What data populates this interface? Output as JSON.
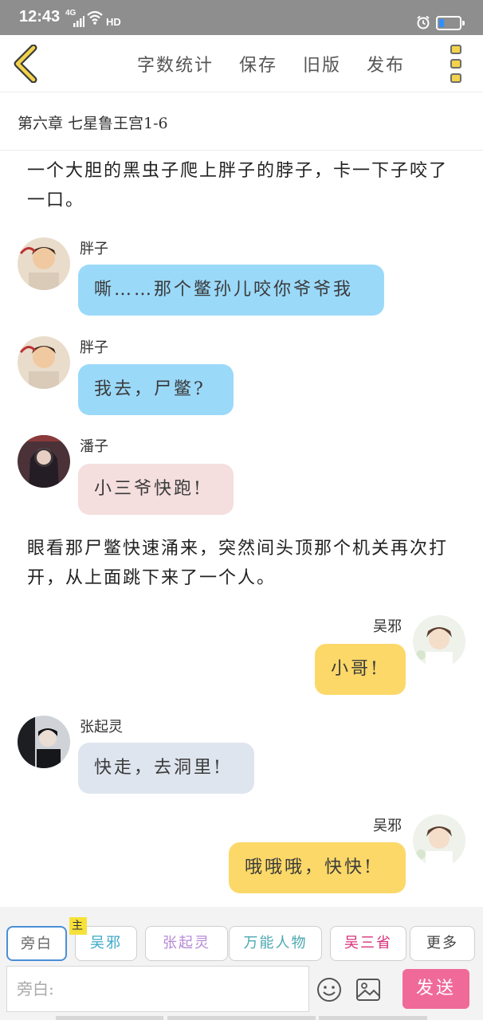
{
  "status_bar": {
    "time": "12:43",
    "signal_label": "4G",
    "hd_label": "HD",
    "battery_color": "#2f8fff"
  },
  "header": {
    "back_icon": "chevron-left-icon",
    "actions": [
      "字数统计",
      "保存",
      "旧版",
      "发布"
    ],
    "menu_icon": "vertical-dots-icon"
  },
  "chapter_title": "第六章 七星鲁王宫1-6",
  "messages": [
    {
      "type": "narration",
      "text": "一个大胆的黑虫子爬上胖子的脖子，卡一下子咬了一口。"
    },
    {
      "type": "chat",
      "side": "left",
      "speaker": "胖子",
      "text": "嘶……那个鳖孙儿咬你爷爷我",
      "color": "#9bd9f9"
    },
    {
      "type": "chat",
      "side": "left",
      "speaker": "胖子",
      "text": "我去，尸鳖?",
      "color": "#9bd9f9"
    },
    {
      "type": "chat",
      "side": "left",
      "speaker": "潘子",
      "text": "小三爷快跑!",
      "color": "#f4dede"
    },
    {
      "type": "narration",
      "text": "眼看那尸鳖快速涌来，突然间头顶那个机关再次打开，从上面跳下来了一个人。"
    },
    {
      "type": "chat",
      "side": "right",
      "speaker": "吴邪",
      "text": "小哥!",
      "color": "#fbd868"
    },
    {
      "type": "chat",
      "side": "left",
      "speaker": "张起灵",
      "text": "快走，去洞里!",
      "color": "#dfe5ee"
    },
    {
      "type": "chat",
      "side": "right",
      "speaker": "吴邪",
      "text": "哦哦哦，快快!",
      "color": "#fbd868"
    }
  ],
  "roles": [
    {
      "label": "旁白",
      "color": "#666666",
      "active": true
    },
    {
      "label": "吴邪",
      "color": "#3aa8c9",
      "badge": "主"
    },
    {
      "label": "张起灵",
      "color": "#b68ad6"
    },
    {
      "label": "万能人物",
      "color": "#4aa8b0"
    },
    {
      "label": "吴三省",
      "color": "#d6337a"
    },
    {
      "label": "更多",
      "color": "#444444"
    }
  ],
  "composer": {
    "placeholder": "旁白:",
    "send_label": "发送",
    "emoji_icon": "smiley-icon",
    "image_icon": "image-icon"
  }
}
